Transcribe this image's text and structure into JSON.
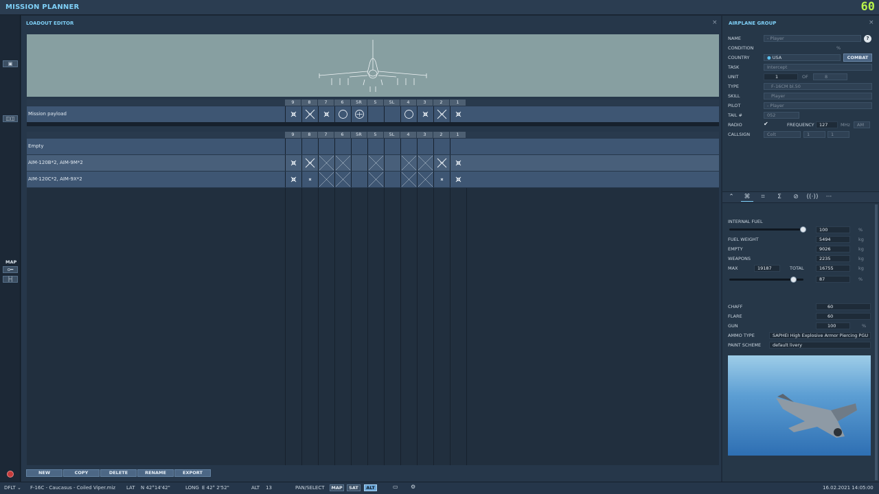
{
  "app": {
    "title": "MISSION PLANNER",
    "fps": "60"
  },
  "left_strip": {
    "map_label": "MAP"
  },
  "loadout": {
    "title": "LOADOUT EDITOR",
    "station_headers": [
      "9",
      "8",
      "7",
      "6",
      "5R",
      "5",
      "5L",
      "4",
      "3",
      "2",
      "1"
    ],
    "mission_payload_label": "Mission payload",
    "presets": [
      {
        "label": "Empty"
      },
      {
        "label": "AIM-120B*2, AIM-9M*2"
      },
      {
        "label": "AIM-120C*2, AIM-9X*2"
      }
    ],
    "buttons": {
      "new": "NEW",
      "copy": "COPY",
      "delete": "DELETE",
      "rename": "RENAME",
      "export": "EXPORT"
    }
  },
  "airplane_group": {
    "title": "AIRPLANE GROUP",
    "name_label": "NAME",
    "name_value": "- Player",
    "help": "?",
    "condition_label": "CONDITION",
    "condition_unit": "%",
    "country_label": "COUNTRY",
    "country_value": "USA",
    "combat_label": "COMBAT",
    "task_label": "TASK",
    "task_value": "Intercept",
    "unit_label": "UNIT",
    "unit_value": "1",
    "of_label": "OF",
    "of_value": "8",
    "type_label": "TYPE",
    "type_value": "F-16CM bl.50",
    "skill_label": "SKILL",
    "skill_value": "Player",
    "pilot_label": "PILOT",
    "pilot_value": "- Player",
    "tail_label": "TAIL #",
    "tail_value": "052",
    "radio_label": "RADIO",
    "frequency_label": "FREQUENCY",
    "frequency_value": "127",
    "mhz": "MHz",
    "am": "AM",
    "callsign_label": "CALLSIGN",
    "callsign_value": "Colt",
    "callsign_n1": "1",
    "callsign_n2": "1"
  },
  "payload": {
    "internal_fuel_label": "INTERNAL FUEL",
    "internal_fuel_value": "100",
    "internal_fuel_level": 1.0,
    "percent": "%",
    "kg": "kg",
    "fuel_weight_label": "FUEL WEIGHT",
    "fuel_weight_value": "5494",
    "empty_label": "EMPTY",
    "empty_value": "9026",
    "weapons_label": "WEAPONS",
    "weapons_value": "2235",
    "max_label": "MAX",
    "max_value": "19187",
    "total_label": "TOTAL",
    "total_value": "16755",
    "total_pct_value": "87",
    "total_pct_level": 0.87,
    "chaff_label": "CHAFF",
    "chaff_value": "60",
    "flare_label": "FLARE",
    "flare_value": "60",
    "gun_label": "GUN",
    "gun_value": "100",
    "ammo_type_label": "AMMO TYPE",
    "ammo_type_value": "SAPHEI High Explosive Armor Piercing PGU",
    "paint_scheme_label": "PAINT SCHEME",
    "paint_scheme_value": "default livery"
  },
  "status": {
    "profile": "DFLT",
    "mission": "F-16C - Caucasus - Coiled Viper.miz",
    "lat_label": "LAT",
    "lat_value": "N 42°14'42\"",
    "long_label": "LONG",
    "long_value": "E 42° 2'52\"",
    "alt_label": "ALT",
    "alt_value": "13",
    "pan_select": "PAN/SELECT",
    "map": "MAP",
    "sat": "SAT",
    "alt_btn": "ALT",
    "datetime": "16.02.2021 14:05:00"
  },
  "colors": {
    "accent": "#7fd0f7",
    "fps": "#b8f24a",
    "panel": "#26374a"
  }
}
